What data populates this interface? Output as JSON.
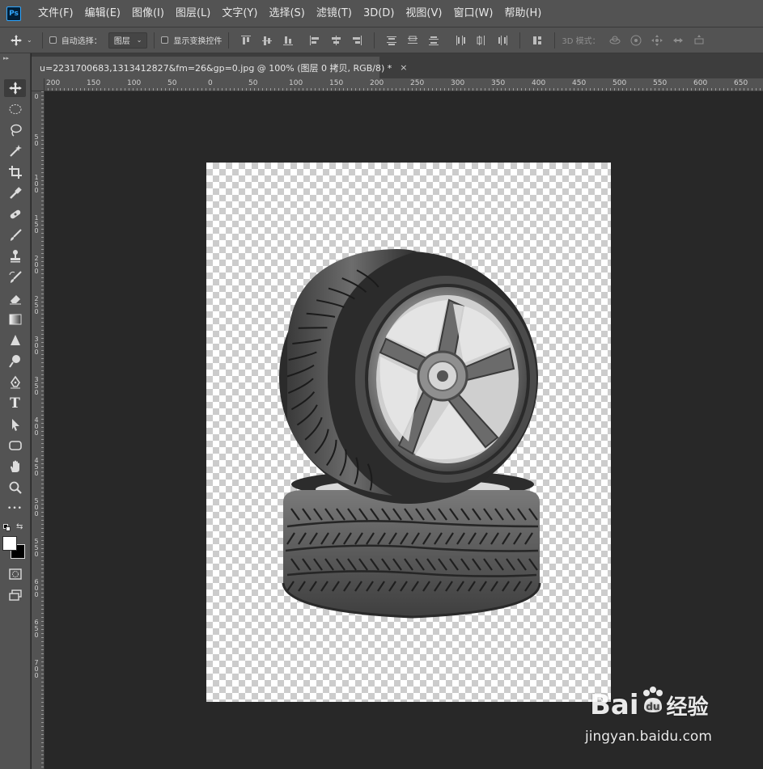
{
  "app": {
    "logo_text": "Ps"
  },
  "menu": {
    "items": [
      "文件(F)",
      "编辑(E)",
      "图像(I)",
      "图层(L)",
      "文字(Y)",
      "选择(S)",
      "滤镜(T)",
      "3D(D)",
      "视图(V)",
      "窗口(W)",
      "帮助(H)"
    ]
  },
  "options": {
    "auto_select_label": "自动选择：",
    "auto_select_value": "图层",
    "show_transform_label": "显示变换控件",
    "mode_3d_label": "3D 模式："
  },
  "document": {
    "tab_title": "u=2231700683,1313412827&fm=26&gp=0.jpg @ 100% (图层 0 拷贝, RGB/8) *",
    "close_glyph": "×"
  },
  "ruler_top": {
    "labels": [
      "200",
      "150",
      "100",
      "50",
      "0",
      "50",
      "100",
      "150",
      "200",
      "250",
      "300",
      "350",
      "400",
      "450",
      "500",
      "550",
      "600",
      "650"
    ]
  },
  "ruler_left": {
    "labels": [
      "0",
      "50",
      "100",
      "150",
      "200",
      "250",
      "300",
      "350",
      "400",
      "450",
      "500",
      "550",
      "600",
      "650",
      "700"
    ]
  },
  "toolbar": {
    "tools": [
      "move-tool",
      "marquee-tool",
      "lasso-tool",
      "magic-wand-tool",
      "crop-tool",
      "eyedropper-tool",
      "healing-brush-tool",
      "brush-tool",
      "clone-stamp-tool",
      "history-brush-tool",
      "eraser-tool",
      "gradient-tool",
      "blur-tool",
      "dodge-tool",
      "pen-tool",
      "type-tool",
      "path-selection-tool",
      "rectangle-tool",
      "hand-tool",
      "zoom-tool",
      "more-tools"
    ],
    "type_tool_glyph": "T",
    "more_glyph": "•••",
    "foreground_color": "#ffffff",
    "background_color": "#000000"
  },
  "watermark": {
    "brand_left": "Bai",
    "brand_right": "经验",
    "url": "jingyan.baidu.com"
  },
  "colors": {
    "panel": "#535353",
    "canvas_bg": "#282828",
    "accent": "#31a8ff"
  }
}
